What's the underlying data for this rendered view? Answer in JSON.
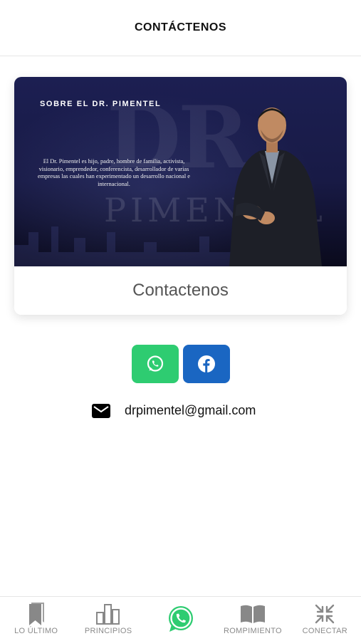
{
  "header": {
    "title": "CONTÁCTENOS"
  },
  "card": {
    "banner": {
      "heading": "SOBRE EL DR. PIMENTEL",
      "body": "El Dr. Pimentel es hijo, padre, hombre de familia, activista, visionario, emprendedor, conferencista, desarrollador de varias empresas las cuales han experimentado un desarrollo nacional e internacional.",
      "watermark_top": "DR",
      "watermark_bottom": "PIMENTEL"
    },
    "label": "Contactenos"
  },
  "social": {
    "whatsapp_color": "#2ecc71",
    "facebook_color": "#1a66c2"
  },
  "contact": {
    "email": "drpimentel@gmail.com"
  },
  "tabbar": {
    "items": [
      {
        "label": "LO ÚLTIMO",
        "icon": "bookmark-icon"
      },
      {
        "label": "PRINCIPIOS",
        "icon": "columns-icon"
      },
      {
        "label": "",
        "icon": "whatsapp-icon"
      },
      {
        "label": "ROMPIMIENTO",
        "icon": "open-book-icon"
      },
      {
        "label": "CONECTAR",
        "icon": "compress-icon"
      }
    ]
  }
}
